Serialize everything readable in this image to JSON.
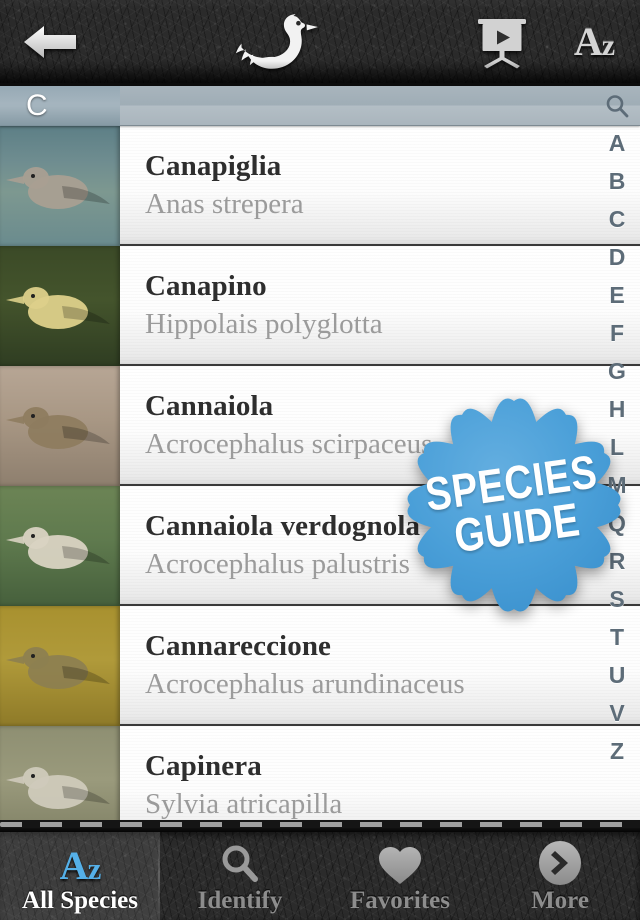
{
  "navbar": {
    "back_icon": "back-arrow-icon",
    "logo_icon": "swan-logo-icon",
    "slideshow_icon": "projector-screen-icon",
    "sort_icon_main": "A",
    "sort_icon_sub": "z"
  },
  "section": {
    "letter": "C"
  },
  "index": {
    "search_icon": "search-icon",
    "letters": [
      "A",
      "B",
      "C",
      "D",
      "E",
      "F",
      "G",
      "H",
      "L",
      "M",
      "Q",
      "R",
      "S",
      "T",
      "U",
      "V",
      "Z"
    ]
  },
  "badge": {
    "line1": "SPECIES",
    "line2": "GUIDE",
    "color": "#4a9fd8"
  },
  "list": {
    "rows": [
      {
        "name": "Canapiglia",
        "latin": "Anas strepera",
        "thumb": "gadwall-swimming-photo"
      },
      {
        "name": "Canapino",
        "latin": "Hippolais polyglotta",
        "thumb": "melodious-warbler-photo"
      },
      {
        "name": "Cannaiola",
        "latin": "Acrocephalus scirpaceus",
        "thumb": "reed-warbler-photo"
      },
      {
        "name": "Cannaiola verdognola",
        "latin": "Acrocephalus palustris",
        "thumb": "marsh-warbler-photo"
      },
      {
        "name": "Cannareccione",
        "latin": "Acrocephalus arundinaceus",
        "thumb": "great-reed-warbler-photo"
      },
      {
        "name": "Capinera",
        "latin": "Sylvia atricapilla",
        "thumb": "blackcap-photo"
      }
    ]
  },
  "tabs": [
    {
      "label": "All Species",
      "icon": "az-icon",
      "active": true
    },
    {
      "label": "Identify",
      "icon": "search-icon",
      "active": false
    },
    {
      "label": "Favorites",
      "icon": "heart-icon",
      "active": false
    },
    {
      "label": "More",
      "icon": "chevron-right-circle-icon",
      "active": false
    }
  ]
}
